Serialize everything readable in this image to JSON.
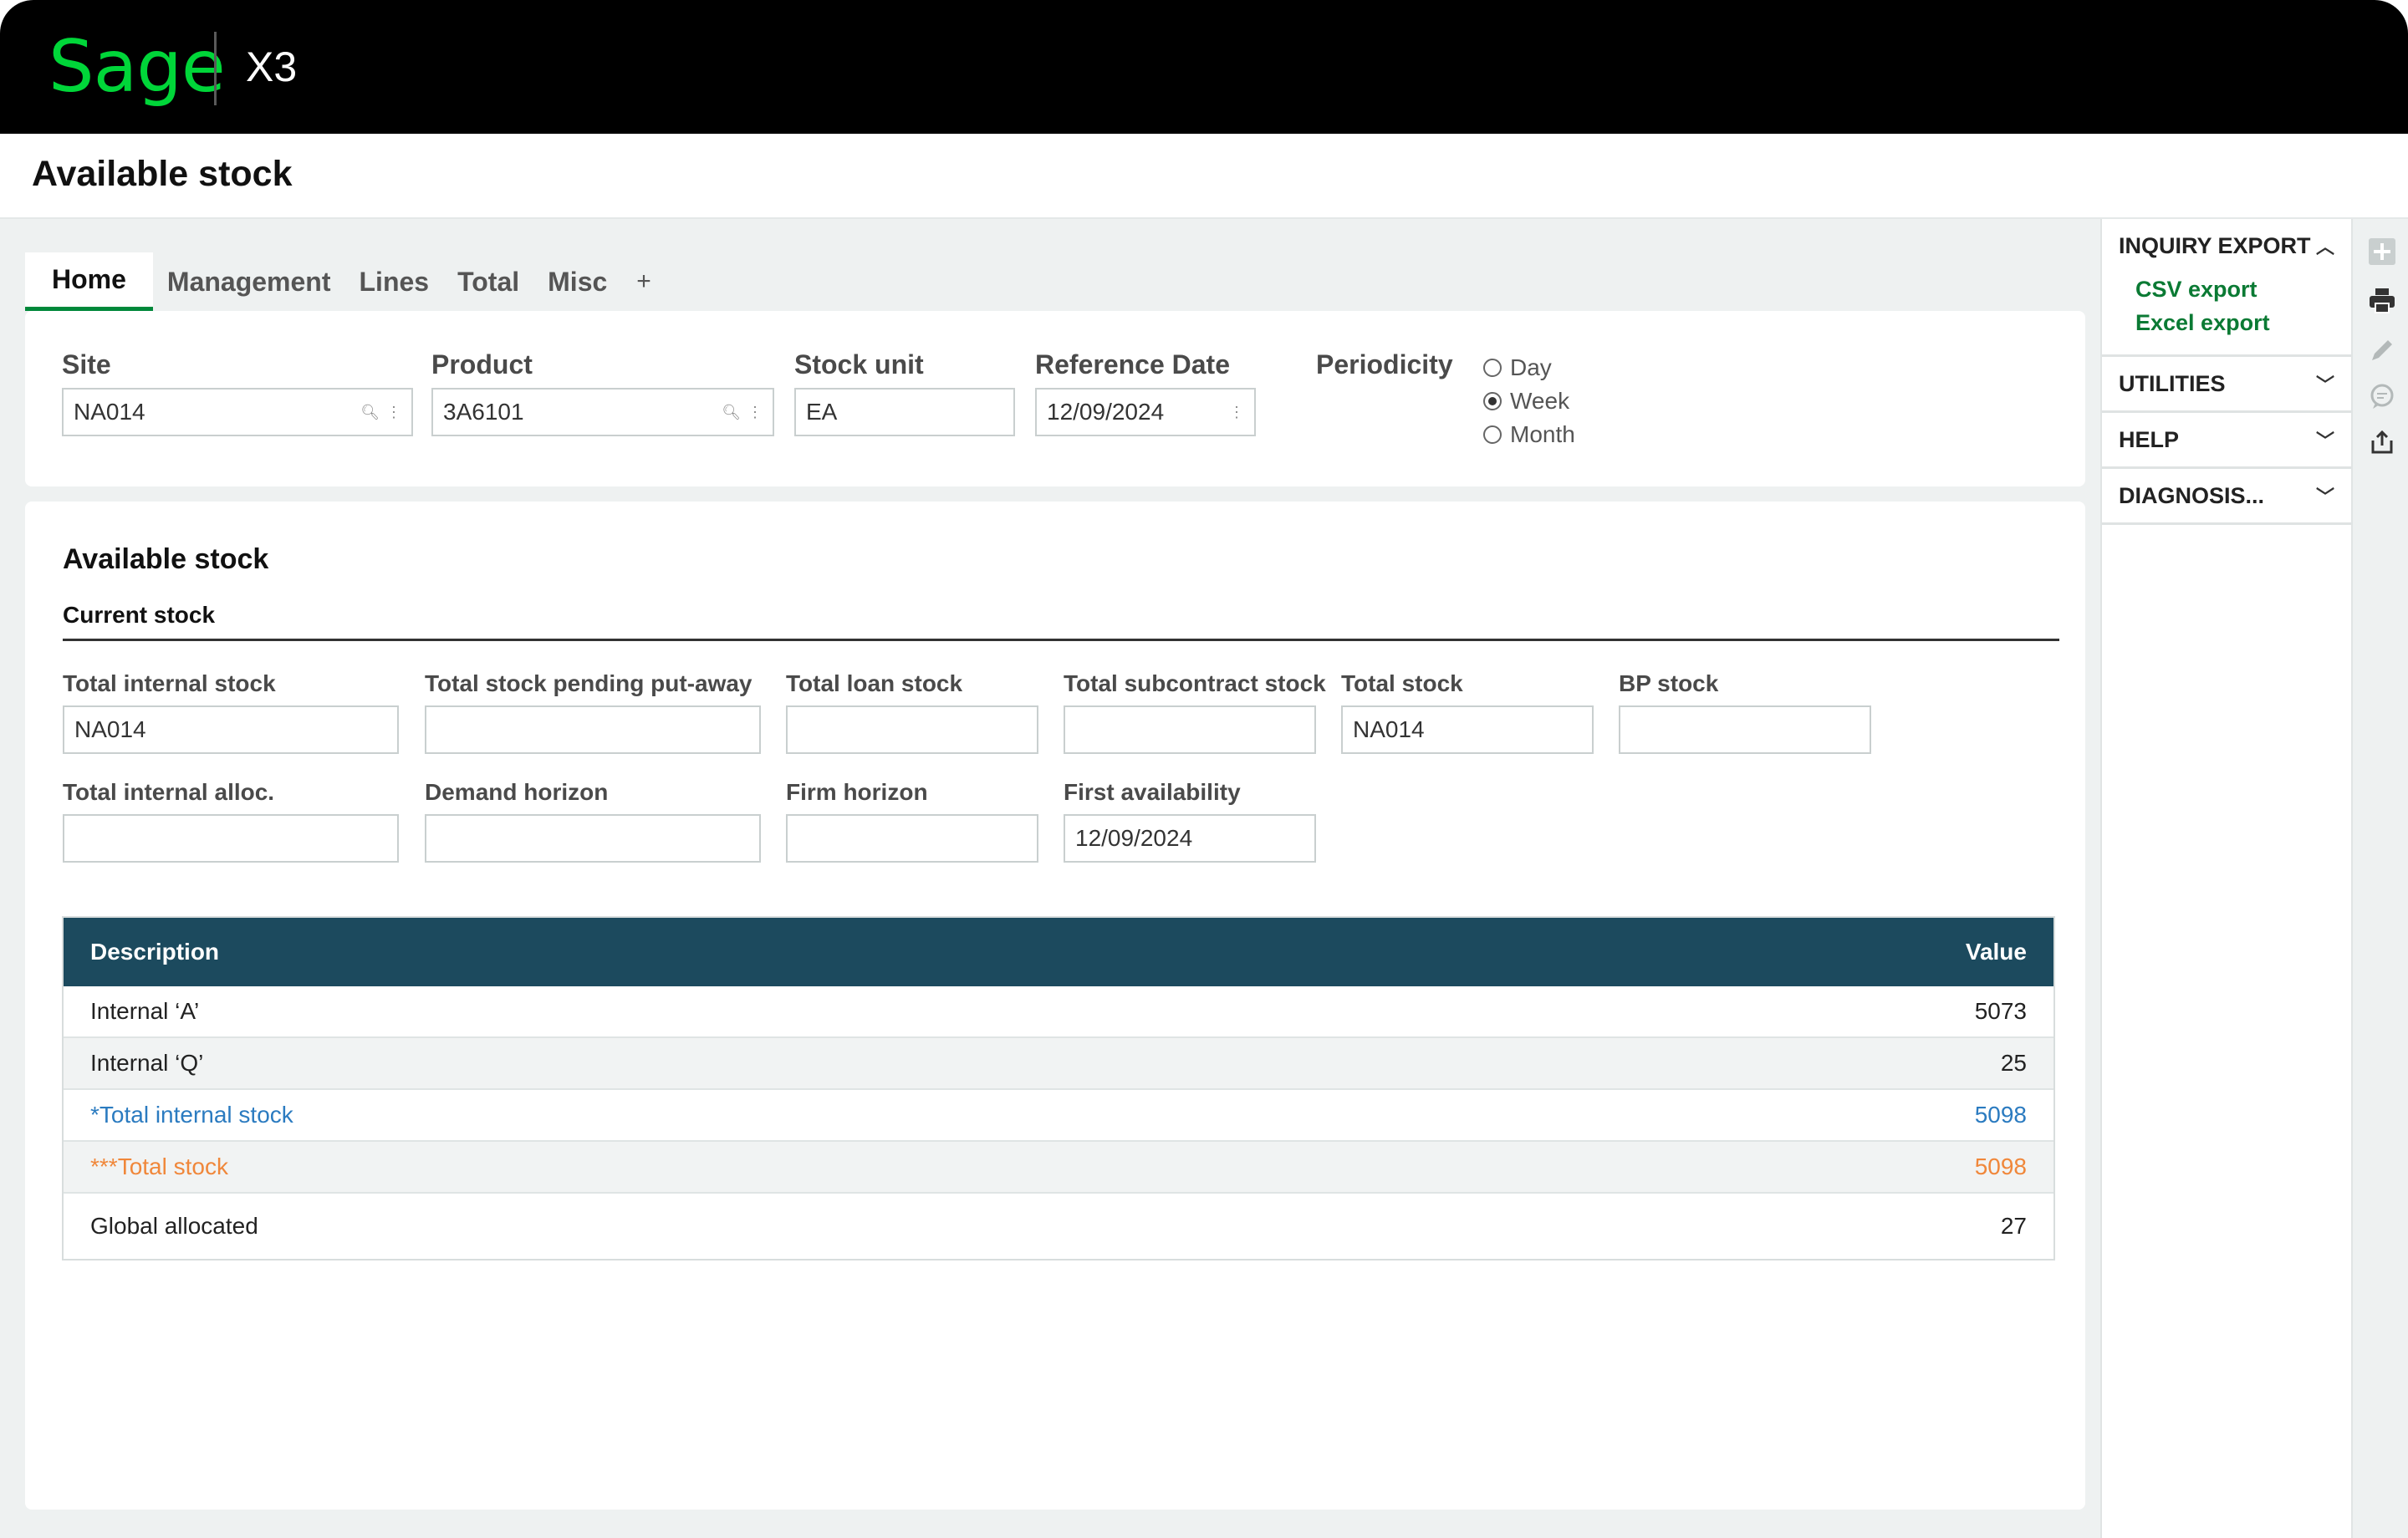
{
  "app": {
    "logo_text": "Sage",
    "product_name": "X3",
    "page_title": "Available stock"
  },
  "tabs": [
    {
      "label": "Home",
      "active": true
    },
    {
      "label": "Management",
      "active": false
    },
    {
      "label": "Lines",
      "active": false
    },
    {
      "label": "Total",
      "active": false
    },
    {
      "label": "Misc",
      "active": false
    },
    {
      "label": "+",
      "active": false
    }
  ],
  "criteria": {
    "site": {
      "label": "Site",
      "value": "NA014"
    },
    "product": {
      "label": "Product",
      "value": "3A6101"
    },
    "stock_unit": {
      "label": "Stock unit",
      "value": "EA"
    },
    "reference_date": {
      "label": "Reference Date",
      "value": "12/09/2024"
    },
    "periodicity": {
      "label": "Periodicity",
      "options": [
        {
          "label": "Day",
          "selected": false
        },
        {
          "label": "Week",
          "selected": true
        },
        {
          "label": "Month",
          "selected": false
        }
      ]
    }
  },
  "panel": {
    "title": "Available stock",
    "subtitle": "Current stock",
    "fields": {
      "total_internal_stock": {
        "label": "Total internal stock",
        "value": "NA014"
      },
      "total_pending_putaway": {
        "label": "Total stock pending put-away",
        "value": ""
      },
      "total_loan_stock": {
        "label": "Total loan stock",
        "value": ""
      },
      "total_subcontract_stock": {
        "label": "Total subcontract stock",
        "value": ""
      },
      "total_stock": {
        "label": "Total stock",
        "value": "NA014"
      },
      "bp_stock": {
        "label": "BP stock",
        "value": ""
      },
      "total_internal_alloc": {
        "label": "Total internal alloc.",
        "value": ""
      },
      "demand_horizon": {
        "label": "Demand horizon",
        "value": ""
      },
      "firm_horizon": {
        "label": "Firm horizon",
        "value": ""
      },
      "first_availability": {
        "label": "First availability",
        "value": "12/09/2024"
      }
    }
  },
  "grid": {
    "columns": [
      "Description",
      "Value"
    ],
    "rows": [
      {
        "description": "Internal ‘A’",
        "value": "5073"
      },
      {
        "description": "Internal ‘Q’",
        "value": "25"
      },
      {
        "description": "*Total internal stock",
        "value": "5098"
      },
      {
        "description": "***Total stock",
        "value": "5098"
      },
      {
        "description": "Global allocated",
        "value": "27"
      }
    ]
  },
  "sidebar": {
    "inquiry_export": {
      "title": "INQUIRY EXPORT",
      "links": [
        "CSV export",
        "Excel export"
      ]
    },
    "utilities": "UTILITIES",
    "help": "HELP",
    "diagnosis": "DIAGNOSIS..."
  },
  "colors": {
    "brand_green": "#00d639",
    "link_green": "#0b7a34",
    "grid_header": "#1c4a5e",
    "total_internal_blue": "#2b7bc0",
    "total_stock_orange": "#f0873a"
  },
  "tool_icons": [
    "plus-icon",
    "print-icon",
    "pencil-icon",
    "comment-icon",
    "share-icon"
  ]
}
